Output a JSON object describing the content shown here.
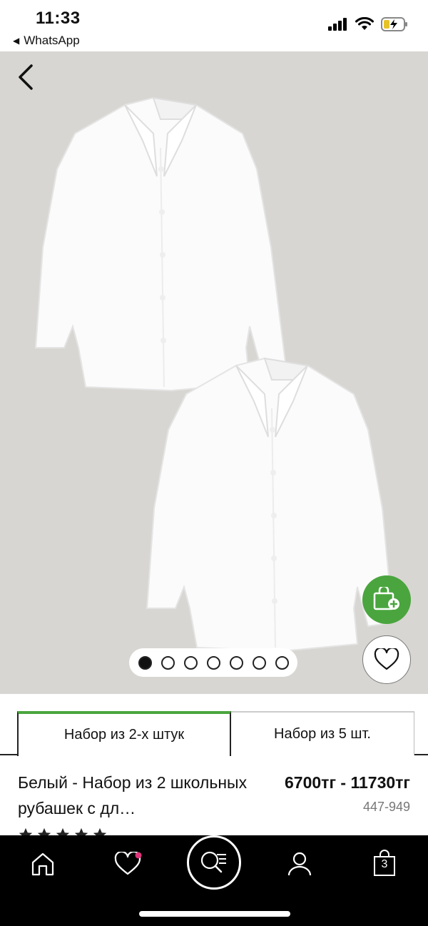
{
  "status_bar": {
    "time": "11:33",
    "back_app": "WhatsApp",
    "back_glyph": "◀"
  },
  "gallery": {
    "total_images": 7,
    "active_index": 0,
    "background": "#d8d6d2"
  },
  "options": {
    "tabs": [
      {
        "label": "Набор из 2-х штук",
        "active": true
      },
      {
        "label": "Набор из 5 шт.",
        "active": false
      }
    ]
  },
  "product": {
    "title": "Белый - Набор из 2 школьных рубашек с дл…",
    "price": "6700тг - 11730тг",
    "sku": "447-949"
  },
  "tabbar": {
    "bag_count": "3",
    "items": [
      "home-icon",
      "heart-icon",
      "search-icon",
      "account-icon",
      "bag-icon"
    ]
  },
  "colors": {
    "accent": "#4aa53e",
    "notification": "#e0357a"
  }
}
